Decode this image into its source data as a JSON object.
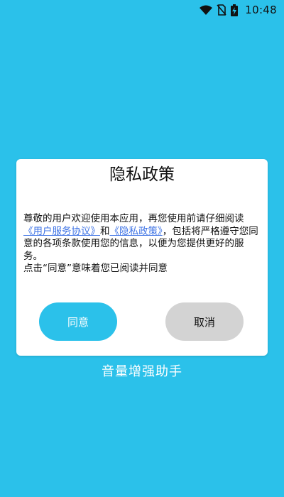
{
  "status_bar": {
    "time": "10:48",
    "icons": [
      "wifi-icon",
      "no-sim-icon",
      "battery-charging-icon"
    ]
  },
  "dialog": {
    "title": "隐私政策",
    "body_intro": " 尊敬的用户欢迎使用本应用，再您使用前请仔细阅读",
    "user_agreement_link": "《用户服务协议》",
    "and_text": "和",
    "privacy_policy_link": "《隐私政策》",
    "body_rest": "，包括将严格遵守您同意的各项条款使用您的信息，以便为您提供更好的服务。",
    "consent_note": "点击“同意”意味着您已阅读并同意",
    "agree_button": "同意",
    "cancel_button": "取消"
  },
  "app_name": "音量增强助手",
  "colors": {
    "background": "#2bc1ea",
    "agree_button": "#2bc1ea",
    "cancel_button": "#d3d3d3",
    "link": "#3e73e5"
  }
}
